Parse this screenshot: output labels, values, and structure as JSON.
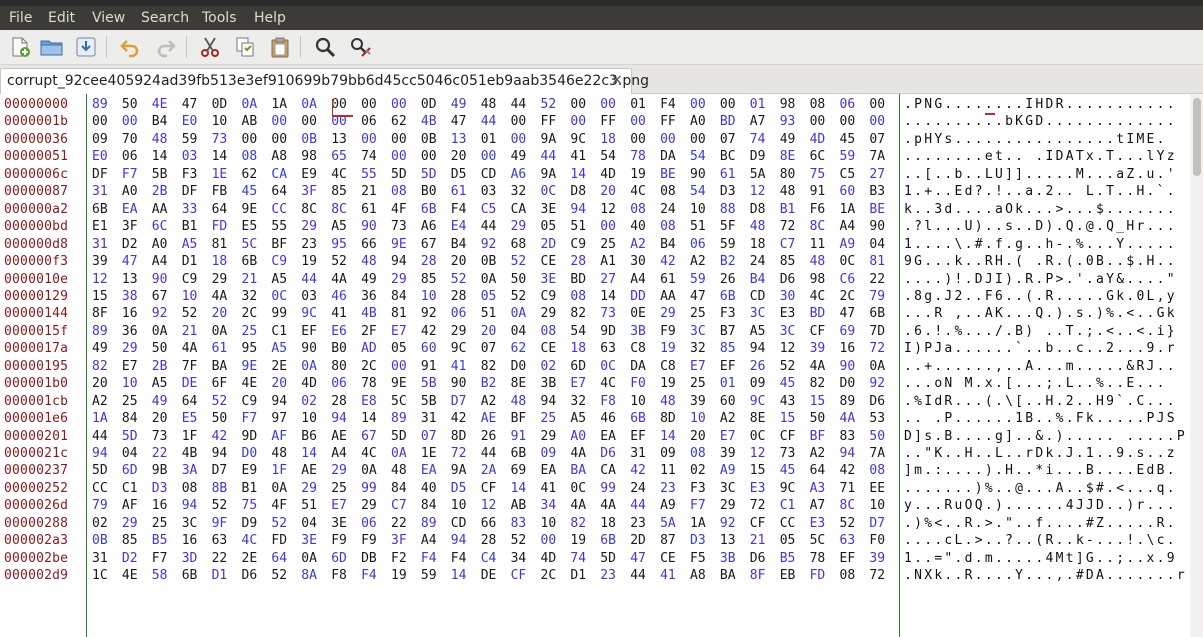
{
  "menu": [
    "File",
    "Edit",
    "View",
    "Search",
    "Tools",
    "Help"
  ],
  "toolbar_icons": [
    "new-file-icon",
    "open-folder-icon",
    "save-icon",
    "undo-icon",
    "redo-icon",
    "cut-icon",
    "copy-icon",
    "paste-icon",
    "find-icon",
    "replace-icon"
  ],
  "tab": {
    "label": "corrupt_92cee405924ad39fb513e3ef910699b79bb6d45cc5046c051eb9aab3546e22c3.png",
    "close": "×"
  },
  "colors": {
    "byte_blue": "#3a3ad6",
    "byte_black": "#1a1a1a",
    "offset": "#8b1a1a",
    "divider": "#2e7d32"
  },
  "rows": [
    {
      "offset": "00000000",
      "bytes": "89 50 4E 47 0D 0A 1A 0A 00 00 00 0D 49 48 44 52 00 00 01 F4 00 00 01 98 08 06 00",
      "ascii": ".PNG........IHDR..........."
    },
    {
      "offset": "0000001b",
      "bytes": "00 00 B4 E0 10 AB 00 00 00 06 62 4B 47 44 00 FF 00 FF 00 FF A0 BD A7 93 00 00 00",
      "ascii": "..........bKGD............."
    },
    {
      "offset": "00000036",
      "bytes": "09 70 48 59 73 00 00 0B 13 00 00 0B 13 01 00 9A 9C 18 00 00 00 07 74 49 4D 45 07",
      "ascii": ".pHYs................tIME."
    },
    {
      "offset": "00000051",
      "bytes": "E0 06 14 03 14 08 A8 98 65 74 00 00 20 00 49 44 41 54 78 DA 54 BC D9 8E 6C 59 7A",
      "ascii": "........et.. .IDATx.T...lYz"
    },
    {
      "offset": "0000006c",
      "bytes": "DF F7 5B F3 1E 62 CA E9 4C 55 5D 5D D5 CD A6 9A 14 4D 19 BE 90 61 5A 80 75 C5 27",
      "ascii": "..[..b..LU]].....M...aZ.u.'"
    },
    {
      "offset": "00000087",
      "bytes": "31 A0 2B DF FB 45 64 3F 85 21 08 B0 61 03 32 0C D8 20 4C 08 54 D3 12 48 91 60 B3",
      "ascii": "1.+..Ed?.!..a.2.. L.T..H.`."
    },
    {
      "offset": "000000a2",
      "bytes": "6B EA AA 33 64 9E CC 8C 8C 61 4F 6B F4 C5 CA 3E 94 12 08 24 10 88 D8 B1 F6 1A BE",
      "ascii": "k..3d....aOk...>...$......."
    },
    {
      "offset": "000000bd",
      "bytes": "E1 3F 6C B1 FD E5 55 29 A5 90 73 A6 E4 44 29 05 51 00 40 08 51 5F 48 72 8C A4 90",
      "ascii": ".?l...U)..s..D).Q.@.Q_Hr..."
    },
    {
      "offset": "000000d8",
      "bytes": "31 D2 A0 A5 81 5C BF 23 95 66 9E 67 B4 92 68 2D C9 25 A2 B4 06 59 18 C7 11 A9 04",
      "ascii": "1....\\.#.f.g..h-.%...Y....."
    },
    {
      "offset": "000000f3",
      "bytes": "39 47 A4 D1 18 6B C9 19 52 48 94 28 20 0B 52 CE 28 A1 30 42 A2 B2 24 85 48 0C 81",
      "ascii": "9G...k..RH.( .R.(.0B..$.H.."
    },
    {
      "offset": "0000010e",
      "bytes": "12 13 90 C9 29 21 A5 44 4A 49 29 85 52 0A 50 3E BD 27 A4 61 59 26 B4 D6 98 C6 22",
      "ascii": "....)!.DJI).R.P>.'.aY&....\""
    },
    {
      "offset": "00000129",
      "bytes": "15 38 67 10 4A 32 0C 03 46 36 84 10 28 05 52 C9 08 14 DD AA 47 6B CD 30 4C 2C 79",
      "ascii": ".8g.J2..F6..(.R.....Gk.0L,y"
    },
    {
      "offset": "00000144",
      "bytes": "8F 16 92 52 20 2C 99 9C 41 4B 81 92 06 51 0A 29 82 73 0E 29 25 F3 3C E3 BD 47 6B",
      "ascii": "...R ,..AK...Q.).s.)%.<..Gk"
    },
    {
      "offset": "0000015f",
      "bytes": "89 36 0A 21 0A 25 C1 EF E6 2F E7 42 29 20 04 08 54 9D 3B F9 3C B7 A5 3C CF 69 7D",
      "ascii": ".6.!.%.../.B) ..T.;.<..<.i}"
    },
    {
      "offset": "0000017a",
      "bytes": "49 29 50 4A 61 95 A5 90 B0 AD 05 60 9C 07 62 CE 18 63 C8 19 32 85 94 12 39 16 72",
      "ascii": "I)PJa......`..b..c..2...9.r"
    },
    {
      "offset": "00000195",
      "bytes": "82 E7 2B 7F BA 9E 2E 0A 80 2C 00 91 41 82 D0 02 6D 0C DA C8 E7 EF 26 52 4A 90 0A",
      "ascii": "..+......,..A...m.....&RJ.."
    },
    {
      "offset": "000001b0",
      "bytes": "20 10 A5 DE 6F 4E 20 4D 06 78 9E 5B 90 B2 8E 3B E7 4C F0 19 25 01 09 45 82 D0 92",
      "ascii": " ...oN M.x.[...;.L..%..E..."
    },
    {
      "offset": "000001cb",
      "bytes": "A2 25 49 64 52 C9 94 02 28 E8 5C 5B D7 A2 48 94 32 F8 10 48 39 60 9C 43 15 89 D6",
      "ascii": ".%IdR...(.\\[..H.2..H9`.C..."
    },
    {
      "offset": "000001e6",
      "bytes": "1A 84 20 E5 50 F7 97 10 94 14 89 31 42 AE BF 25 A5 46 6B 8D 10 A2 8E 15 50 4A 53",
      "ascii": ".. .P......1B..%.Fk.....PJS"
    },
    {
      "offset": "00000201",
      "bytes": "44 5D 73 1F 42 9D AF B6 AE 67 5D 07 8D 26 91 29 A0 EA EF 14 20 E7 0C CF BF 83 50",
      "ascii": "D]s.B....g]..&.)..... .....P"
    },
    {
      "offset": "0000021c",
      "bytes": "94 04 22 4B 94 D0 48 14 A4 4C 0A 1E 72 44 6B 09 4A D6 31 09 08 39 12 73 A2 94 7A",
      "ascii": "..\"K..H..L..rDk.J.1..9.s..z"
    },
    {
      "offset": "00000237",
      "bytes": "5D 6D 9B 3A D7 E9 1F AE 29 0A 48 EA 9A 2A 69 EA BA CA 42 11 02 A9 15 45 64 42 08",
      "ascii": "]m.:....).H..*i...B....EdB."
    },
    {
      "offset": "00000252",
      "bytes": "CC C1 D3 08 8B B1 0A 29 25 99 84 40 D5 CF 14 41 0C 99 24 23 F3 3C E3 9C A3 71 EE",
      "ascii": ".......)%..@...A..$#.<...q."
    },
    {
      "offset": "0000026d",
      "bytes": "79 AF 16 94 52 75 4F 51 E7 29 C7 84 10 12 AB 34 4A 4A 44 A9 F7 29 72 C1 A7 8C 10",
      "ascii": "y...RuOQ.)......4JJD..)r..."
    },
    {
      "offset": "00000288",
      "bytes": "02 29 25 3C 9F D9 52 04 3E 06 22 89 CD 66 83 10 82 18 23 5A 1A 92 CF CC E3 52 D7",
      "ascii": ".)%<..R.>.\"..f....#Z.....R."
    },
    {
      "offset": "000002a3",
      "bytes": "0B 85 B5 16 63 4C FD 3E F9 F9 3F A4 94 28 52 00 19 6B 2D 87 D3 13 21 05 5C 63 F0",
      "ascii": "....cL.>..?..(R..k-...!.\\c."
    },
    {
      "offset": "000002be",
      "bytes": "31 D2 F7 3D 22 2E 64 0A 6D DB F2 F4 F4 C4 34 4D 74 5D 47 CE F5 3B D6 B5 78 EF 39",
      "ascii": "1..=\".d.m.....4Mt]G..;..x.9"
    },
    {
      "offset": "000002d9",
      "bytes": "1C 4E 58 6B D1 D6 52 8A F8 F4 19 59 14 DE CF 2C D1 23 44 41 A8 BA 8F EB FD 08 72",
      "ascii": ".NXk..R....Y...,.#DA.......r"
    }
  ]
}
